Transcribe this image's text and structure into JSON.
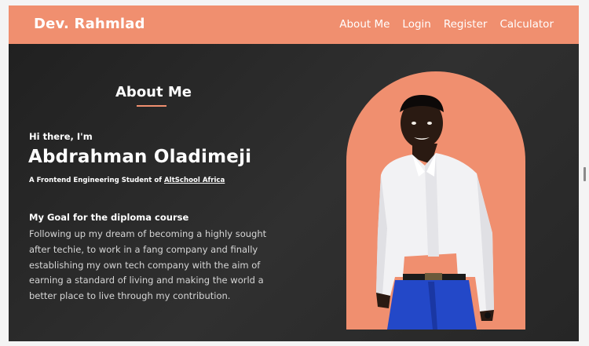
{
  "nav": {
    "brand": "Dev. Rahmlad",
    "links": [
      "About Me",
      "Login",
      "Register",
      "Calculator"
    ]
  },
  "about": {
    "section_title": "About Me",
    "greeting": "Hi there, I'm",
    "name": "Abdrahman Oladimeji",
    "subtitle_prefix": "A Frontend Engineering Student of ",
    "subtitle_link": "AltSchool Africa",
    "goal_title": "My Goal for the diploma course",
    "goal_text": "Following up my dream of becoming a highly sought after techie, to work in a fang company and finally establishing my own tech company with the aim of earning a standard of living and making the world a better place to live through my contribution."
  },
  "colors": {
    "accent": "#f08f6f",
    "background": "#262626",
    "text": "#ffffff"
  }
}
